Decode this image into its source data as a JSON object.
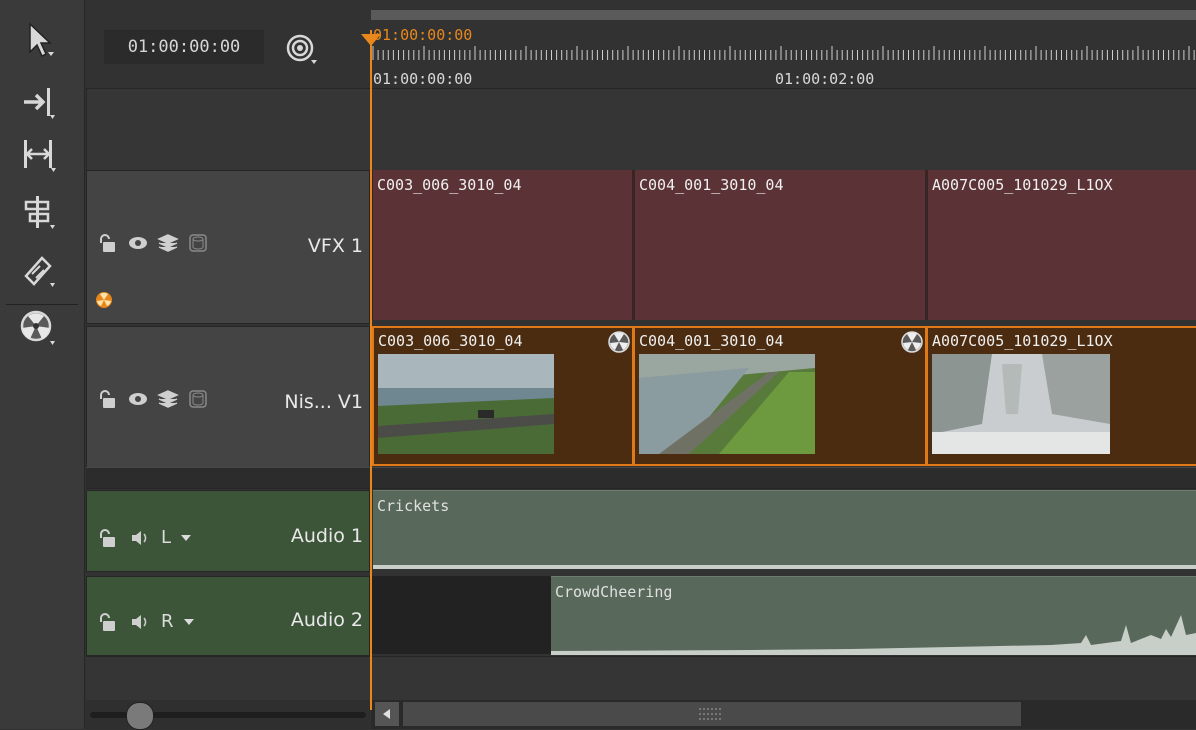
{
  "header": {
    "timecode": "01:00:00:00",
    "playhead_timecode": "01:00:00:00",
    "ruler_labels": [
      "01:00:00:00",
      "01:00:02:00"
    ]
  },
  "tools": [
    "select-tool-icon",
    "track-select-icon",
    "slip-tool-icon",
    "trim-tool-icon",
    "razor-tool-icon",
    "nuke-icon"
  ],
  "tracks": {
    "vfx1": {
      "name": "VFX 1",
      "clips": [
        "C003_006_3010_04",
        "C004_001_3010_04",
        "A007C005_101029_L1OX"
      ]
    },
    "v1": {
      "name": "Nis... V1",
      "clips": [
        "C003_006_3010_04",
        "C004_001_3010_04",
        "A007C005_101029_L1OX"
      ]
    },
    "audio1": {
      "name": "Audio 1",
      "channel": "L",
      "clip": "Crickets"
    },
    "audio2": {
      "name": "Audio 2",
      "channel": "R",
      "clip": "CrowdCheering"
    }
  },
  "colors": {
    "accent": "#e8881c",
    "vfx_clip": "#5b3336",
    "video_clip": "#4b2c10",
    "audio_track": "#3f5a3e",
    "audio_clip": "#58685a"
  }
}
